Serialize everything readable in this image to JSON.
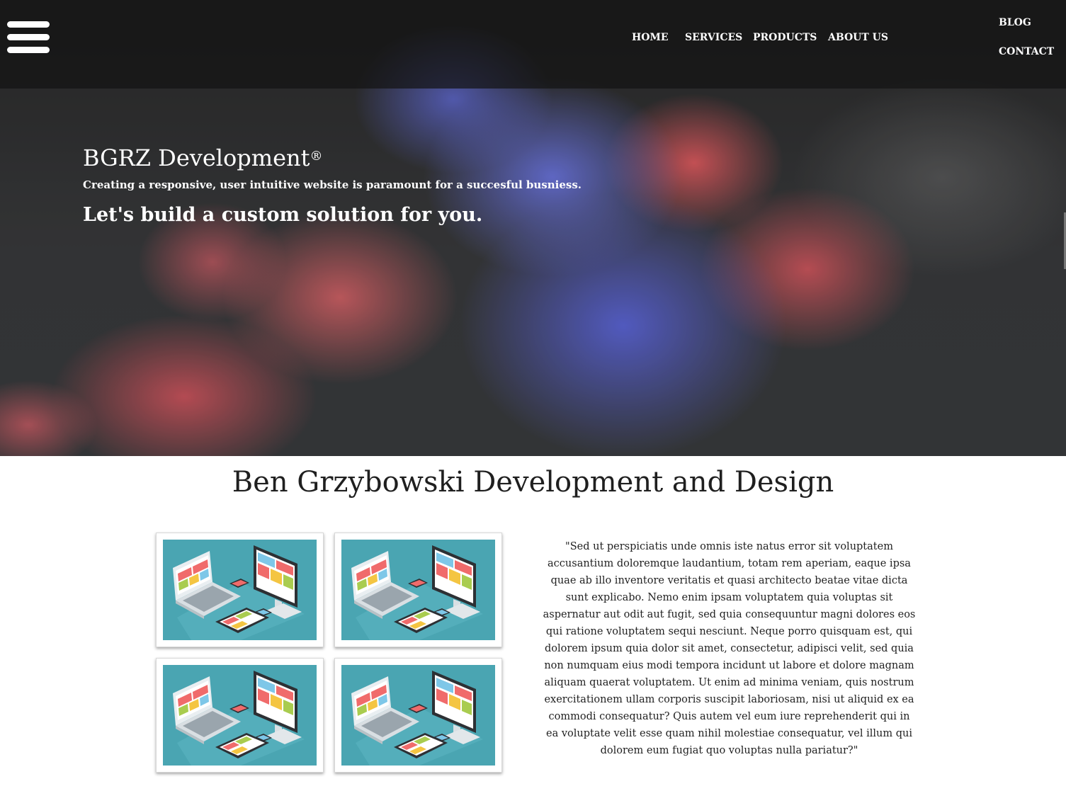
{
  "nav": {
    "home": "HOME",
    "services": "SERVICES",
    "products": "PRODUCTS",
    "about": "ABOUT US",
    "blog": "BLOG",
    "contact": "CONTACT",
    "menu_icon": "hamburger-menu-icon"
  },
  "hero": {
    "brand": "BGRZ Development",
    "brand_mark": "®",
    "tagline": "Creating a responsive, user intuitive website is paramount for a succesful busniess.",
    "cta": "Let's build a custom solution for you."
  },
  "main": {
    "title": "Ben Grzybowski Development and Design",
    "quote": "\"Sed ut perspiciatis unde omnis iste natus error sit voluptatem accusantium doloremque laudantium, totam rem aperiam, eaque ipsa quae ab illo inventore veritatis et quasi architecto beatae vitae dicta sunt explicabo. Nemo enim ipsam voluptatem quia voluptas sit aspernatur aut odit aut fugit, sed quia consequuntur magni dolores eos qui ratione voluptatem sequi nesciunt. Neque porro quisquam est, qui dolorem ipsum quia dolor sit amet, consectetur, adipisci velit, sed quia non numquam eius modi tempora incidunt ut labore et dolore magnam aliquam quaerat voluptatem. Ut enim ad minima veniam, quis nostrum exercitationem ullam corporis suscipit laboriosam, nisi ut aliquid ex ea commodi consequatur? Quis autem vel eum iure reprehenderit qui in ea voluptate velit esse quam nihil molestiae consequatur, vel illum qui dolorem eum fugiat quo voluptas nulla pariatur?\"",
    "cards": [
      {
        "icon": "responsive-devices-icon"
      },
      {
        "icon": "responsive-devices-icon"
      },
      {
        "icon": "responsive-devices-icon"
      },
      {
        "icon": "responsive-devices-icon"
      }
    ]
  },
  "colors": {
    "nav_bg": "#141414",
    "thumb_teal": "#4aa5b2",
    "text_dark": "#222222"
  }
}
